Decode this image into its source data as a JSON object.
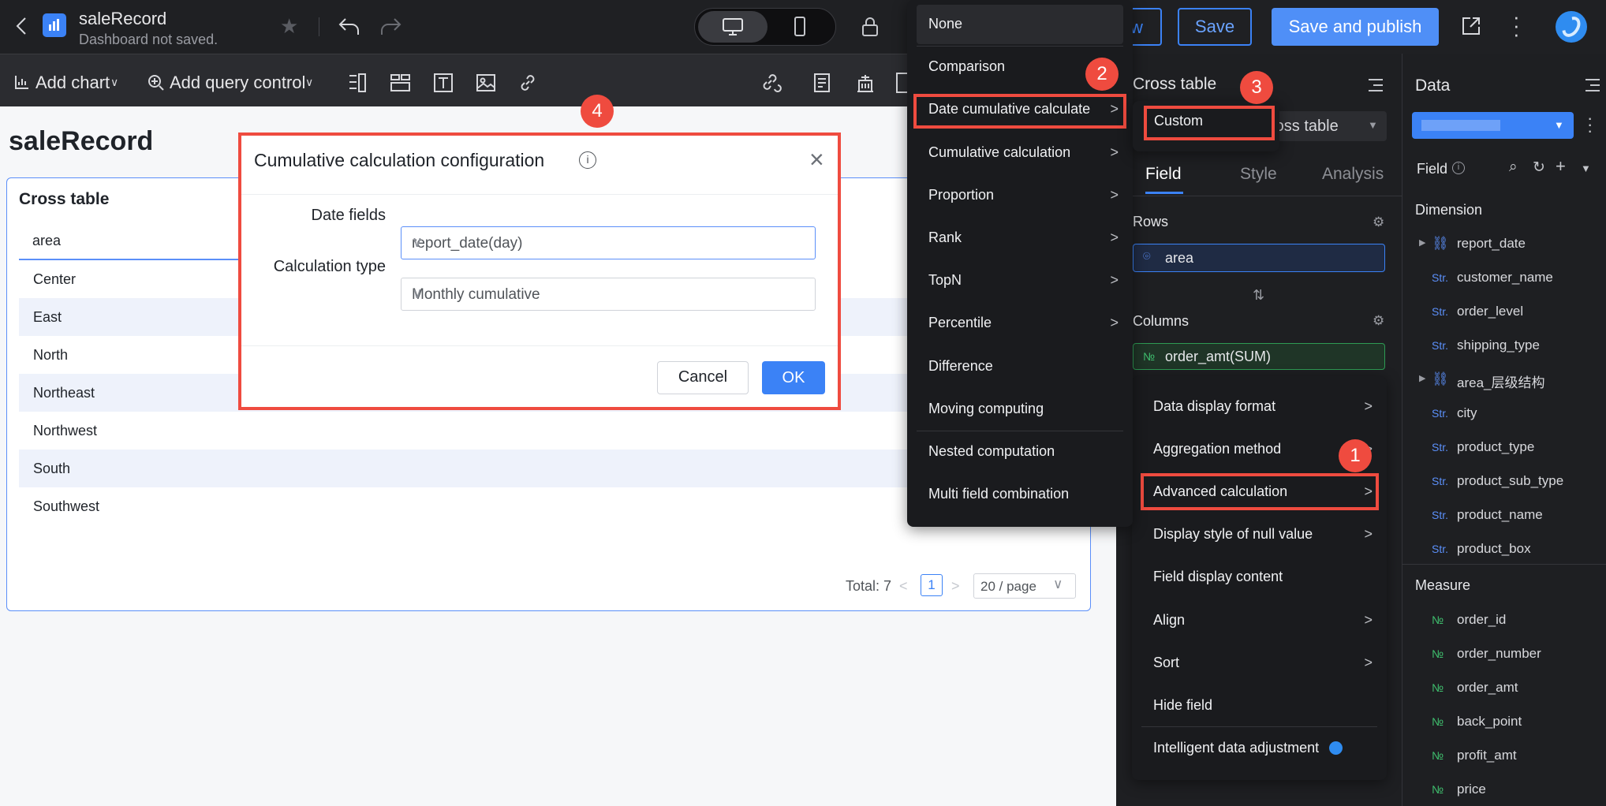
{
  "header": {
    "title": "saleRecord",
    "status": "Dashboard not saved.",
    "preview_partial": "w",
    "save_label": "Save",
    "save_publish_label": "Save and publish"
  },
  "toolbar": {
    "add_chart_label": "Add chart",
    "add_query_control_label": "Add query control"
  },
  "canvas": {
    "page_title": "saleRecord",
    "card_title": "Cross table",
    "column_header": "area",
    "rows": [
      "Center",
      "East",
      "North",
      "Northeast",
      "Northwest",
      "South",
      "Southwest"
    ],
    "pagination": {
      "total": "Total: 7",
      "current_page": "1",
      "page_size": "20 / page"
    }
  },
  "dialog": {
    "title": "Cumulative calculation configuration",
    "date_fields_label": "Date fields",
    "date_fields_value": "report_date(day)",
    "calc_type_label": "Calculation type",
    "calc_type_value": "Monthly cumulative",
    "cancel_label": "Cancel",
    "ok_label": "OK"
  },
  "adv_menu": {
    "items": [
      "None",
      "Comparison",
      "Date cumulative calculate",
      "Cumulative calculation",
      "Proportion",
      "Rank",
      "TopN",
      "Percentile",
      "Difference",
      "Moving computing",
      "Nested computation",
      "Multi field combination"
    ]
  },
  "sub_menu": {
    "custom_label": "Custom"
  },
  "config_panel": {
    "chart_type": "Cross table",
    "chart_select_value": "ross table",
    "tabs": [
      "Field",
      "Style",
      "Analysis"
    ],
    "rows_label": "Rows",
    "rows_field": "area",
    "columns_label": "Columns",
    "columns_field": "order_amt(SUM)"
  },
  "field_menu": {
    "items": [
      "Data display format",
      "Aggregation method",
      "Advanced calculation",
      "Display style of null value",
      "Field display content",
      "Align",
      "Sort",
      "Hide field",
      "Intelligent data adjustment"
    ]
  },
  "data_panel": {
    "title": "Data",
    "field_label": "Field",
    "dimension_label": "Dimension",
    "dimensions": [
      {
        "type": "hier",
        "name": "report_date"
      },
      {
        "type": "Str.",
        "name": "customer_name"
      },
      {
        "type": "Str.",
        "name": "order_level"
      },
      {
        "type": "Str.",
        "name": "shipping_type"
      },
      {
        "type": "hier",
        "name": "area_层级结构"
      },
      {
        "type": "Str.",
        "name": "city"
      },
      {
        "type": "Str.",
        "name": "product_type"
      },
      {
        "type": "Str.",
        "name": "product_sub_type"
      },
      {
        "type": "Str.",
        "name": "product_name"
      },
      {
        "type": "Str.",
        "name": "product_box"
      }
    ],
    "measure_label": "Measure",
    "measures": [
      {
        "type": "№",
        "name": "order_id"
      },
      {
        "type": "№",
        "name": "order_number"
      },
      {
        "type": "№",
        "name": "order_amt"
      },
      {
        "type": "№",
        "name": "back_point"
      },
      {
        "type": "№",
        "name": "profit_amt"
      },
      {
        "type": "№",
        "name": "price"
      }
    ]
  },
  "badges": [
    "1",
    "2",
    "3",
    "4"
  ],
  "colors": {
    "accent": "#3b82f6",
    "highlight": "#ef4b3f",
    "dark_bg": "#1e1f22"
  }
}
